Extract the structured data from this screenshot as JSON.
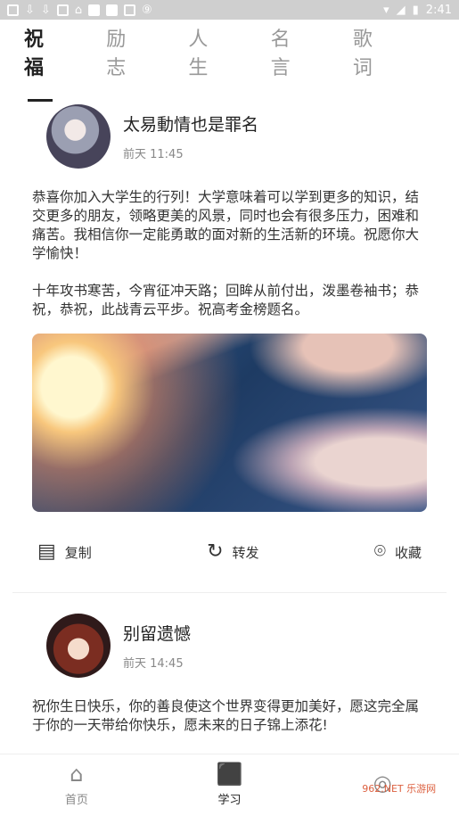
{
  "status_bar": {
    "time": "2:41",
    "icons": [
      "image-icon",
      "download-icon",
      "download-icon",
      "square-icon",
      "house-icon",
      "square-icon",
      "square-icon",
      "square-icon",
      "nine-icon"
    ],
    "right_icons": [
      "wifi-icon",
      "signal-icon",
      "battery-icon"
    ]
  },
  "tabs": [
    "祝福",
    "励志",
    "人生",
    "名言",
    "歌词"
  ],
  "active_tab_index": 0,
  "posts": [
    {
      "author": "太易動情也是罪名",
      "time": "前天 11:45",
      "text": "恭喜你加入大学生的行列！大学意味着可以学到更多的知识，结交更多的朋友，领略更美的风景，同时也会有很多压力，困难和痛苦。我相信你一定能勇敢的面对新的生活新的环境。祝愿你大学愉快！\n\n十年攻书寒苦，今宵征冲天路；回眸从前付出，泼墨卷袖书；恭祝，恭祝，此战青云平步。祝高考金榜题名。",
      "actions": [
        "复制",
        "转发",
        "收藏"
      ]
    },
    {
      "author": "别留遗憾",
      "time": "前天 14:45",
      "text": "祝你生日快乐，你的善良使这个世界变得更加美好，愿这完全属于你的一天带给你快乐，愿未来的日子锦上添花!"
    }
  ],
  "bottom_nav": [
    {
      "label": "首页",
      "icon": "home-icon"
    },
    {
      "label": "学习",
      "icon": "study-icon"
    },
    {
      "label": "",
      "icon": "profile-icon"
    }
  ],
  "watermark": "962.NET 乐游网"
}
